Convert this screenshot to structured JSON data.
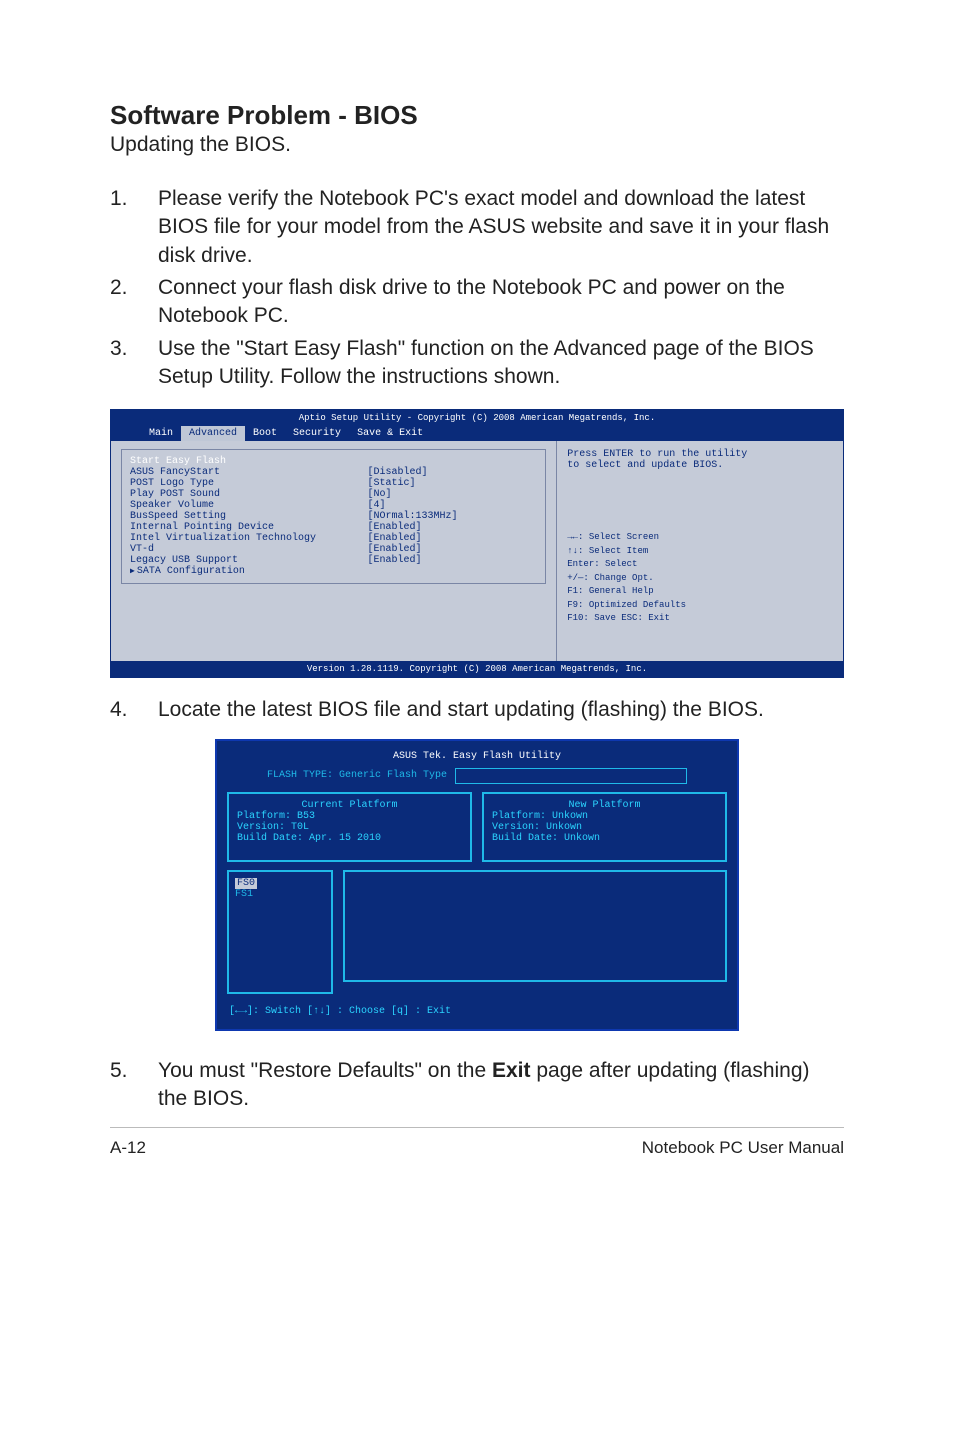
{
  "heading": "Software Problem - BIOS",
  "subheading": "Updating the BIOS.",
  "steps123": [
    {
      "num": "1.",
      "text": "Please verify the Notebook PC's exact model and download the latest BIOS file for your model from the ASUS website and save it in your flash disk drive."
    },
    {
      "num": "2.",
      "text": "Connect your flash disk drive to the Notebook PC and power on the Notebook PC."
    },
    {
      "num": "3.",
      "text": "Use the \"Start Easy Flash\" function on the Advanced page of the BIOS Setup Utility. Follow the instructions shown."
    }
  ],
  "bios": {
    "top": "Aptio Setup Utility - Copyright (C) 2008 American Megatrends, Inc.",
    "menu": [
      "Main",
      "Advanced",
      "Boot",
      "Security",
      "Save & Exit"
    ],
    "active_menu_index": 1,
    "left_items": [
      {
        "label": "Start Easy Flash",
        "value": "",
        "highlight": true
      },
      {
        "label": "ASUS FancyStart",
        "value": "[Disabled]"
      },
      {
        "label": "POST Logo Type",
        "value": "[Static]"
      },
      {
        "label": "Play POST Sound",
        "value": "[No]"
      },
      {
        "label": "Speaker Volume",
        "value": "[4]"
      },
      {
        "label": "BusSpeed Setting",
        "value": "[NOrmal:133MHz]"
      },
      {
        "label": "Internal Pointing Device",
        "value": "[Enabled]"
      },
      {
        "label": "",
        "value": ""
      },
      {
        "label": "Intel Virtualization Technology",
        "value": "[Enabled]"
      },
      {
        "label": "VT-d",
        "value": "[Enabled]"
      },
      {
        "label": "Legacy USB Support",
        "value": "[Enabled]"
      },
      {
        "label": "SATA Configuration",
        "value": "",
        "sub": true
      }
    ],
    "right_msg1": "Press ENTER to run the utility",
    "right_msg2": "to select and update BIOS.",
    "keys": [
      "→←:  Select Screen",
      "↑↓:     Select Item",
      "Enter: Select",
      "+/—:  Change Opt.",
      "F1:     General Help",
      "F9:     Optimized Defaults",
      "F10:  Save    ESC: Exit"
    ],
    "footer": "Version 1.28.1119. Copyright (C) 2008 American Megatrends, Inc."
  },
  "step4": {
    "num": "4.",
    "text": "Locate the latest BIOS file and start updating (flashing) the BIOS."
  },
  "flash": {
    "title": "ASUS Tek. Easy Flash Utility",
    "type_label": "FLASH TYPE: Generic Flash Type",
    "current_title": "Current Platform",
    "current_lines": [
      "Platform:   B53",
      "Version:    T0L",
      "Build Date: Apr. 15 2010"
    ],
    "new_title": "New Platform",
    "new_lines": [
      "Platform:   Unkown",
      "Version:    Unkown",
      "Build Date: Unkown"
    ],
    "fs_sel": "FS0",
    "fs1": "FS1",
    "keys": "[←→]: Switch   [↑↓] : Choose   [q] : Exit"
  },
  "step5_num": "5.",
  "step5_pre": "You must \"Restore Defaults\" on the ",
  "step5_bold": "Exit",
  "step5_post": " page after updating (flashing) the BIOS.",
  "footer_left": "A-12",
  "footer_right": "Notebook PC User Manual"
}
